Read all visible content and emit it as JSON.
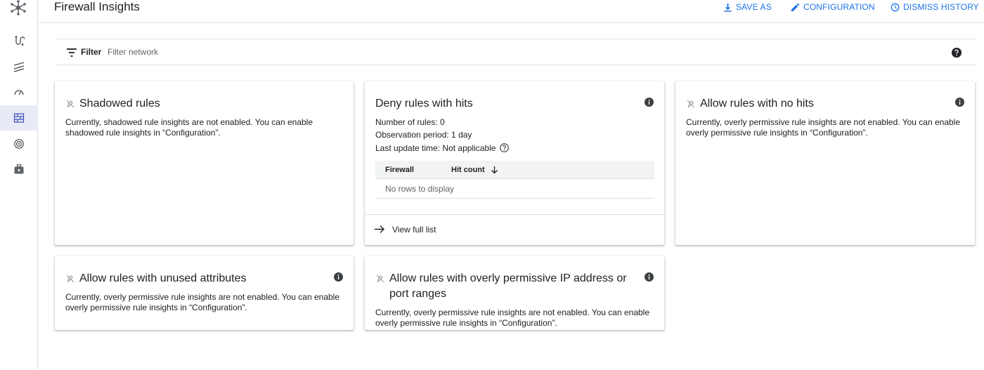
{
  "header": {
    "title": "Firewall Insights",
    "save_as": "SAVE AS",
    "configuration": "CONFIGURATION",
    "dismiss_history": "DISMISS HISTORY"
  },
  "filter": {
    "label": "Filter",
    "placeholder": "Filter network"
  },
  "colors": {
    "accent": "#1a73e8",
    "rail_active_bg": "#e8eaf6"
  },
  "rail": {
    "items": [
      "network-topology-icon",
      "traffic-icon",
      "performance-gauge-icon",
      "firewall-grid-icon",
      "target-icon",
      "toolbox-icon"
    ],
    "active_index": 3
  },
  "cards": {
    "shadowed": {
      "title": "Shadowed rules",
      "body": "Currently, shadowed rule insights are not enabled. You can enable shadowed rule insights in “Configuration”."
    },
    "deny": {
      "title": "Deny rules with hits",
      "num_rules": "Number of rules: 0",
      "observation": "Observation period: 1 day",
      "last_update": "Last update time: Not applicable",
      "col_firewall": "Firewall",
      "col_hitcount": "Hit count",
      "empty": "No rows to display",
      "view_full_list": "View full list"
    },
    "allow_no_hits": {
      "title": "Allow rules with no hits",
      "body": "Currently, overly permissive rule insights are not enabled. You can enable overly permissive rule insights in “Configuration”."
    },
    "unused_attrs": {
      "title": "Allow rules with unused attributes",
      "body": "Currently, overly permissive rule insights are not enabled. You can enable overly permissive rule insights in “Configuration”."
    },
    "permissive_ip": {
      "title": "Allow rules with overly permissive IP address or port ranges",
      "body": "Currently, overly permissive rule insights are not enabled. You can enable overly permissive rule insights in “Configuration”."
    }
  }
}
